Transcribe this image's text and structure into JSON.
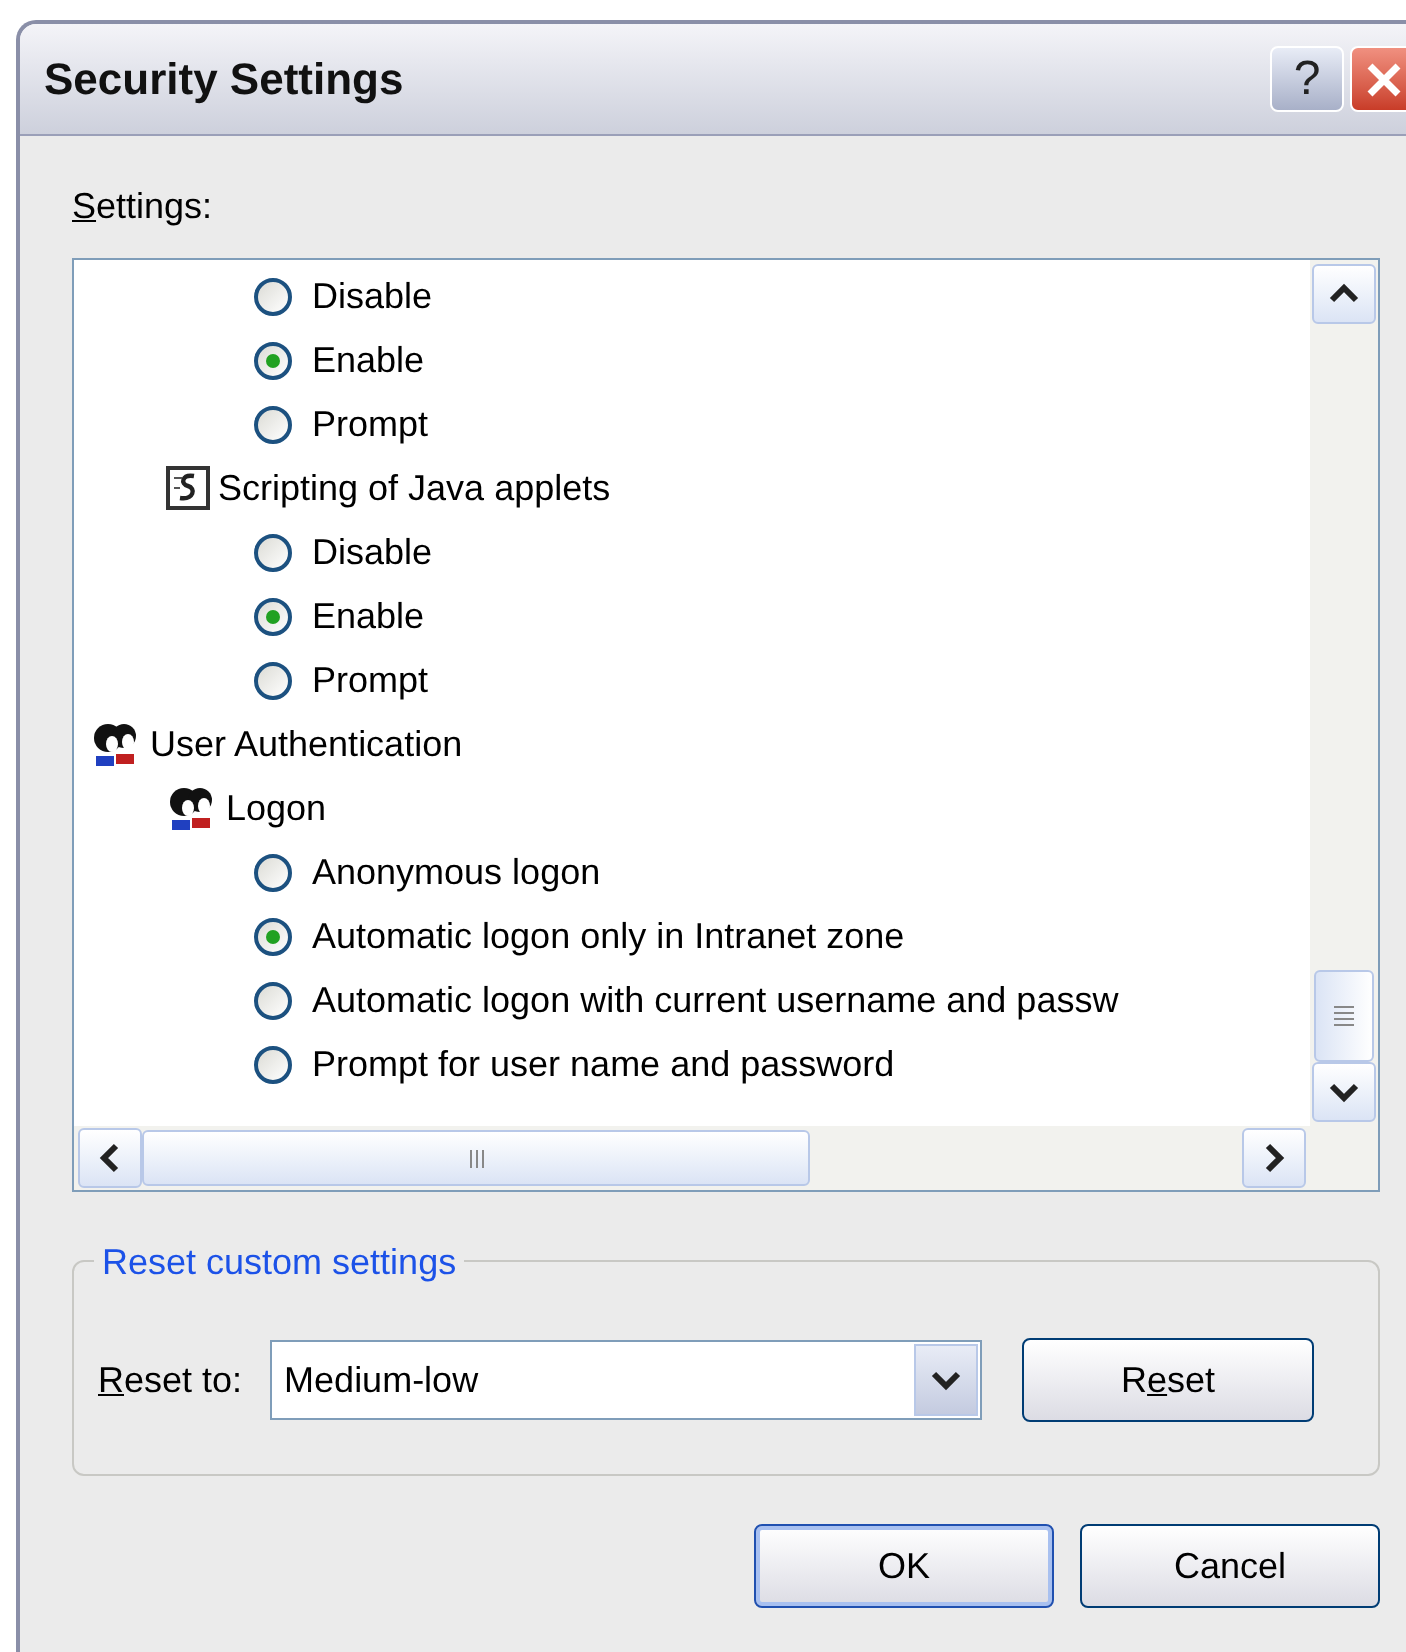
{
  "window": {
    "title": "Security Settings"
  },
  "title_buttons": [
    {
      "kind": "help",
      "label": "?"
    },
    {
      "kind": "close"
    }
  ],
  "settings_label": "Settings:",
  "tree": [
    {
      "children": [
        {
          "children": [
            {
              "label": "Disable",
              "selected": false
            },
            {
              "label": "Enable",
              "selected": true
            },
            {
              "label": "Prompt",
              "selected": false
            }
          ]
        },
        {
          "kind": "script",
          "label": "Scripting of Java applets",
          "children": [
            {
              "label": "Disable",
              "selected": false
            },
            {
              "label": "Enable",
              "selected": true
            },
            {
              "label": "Prompt",
              "selected": false
            }
          ]
        }
      ]
    },
    {
      "kind": "users",
      "label": "User Authentication",
      "children": [
        {
          "kind": "users",
          "label": "Logon",
          "children": [
            {
              "label": "Anonymous logon",
              "selected": false
            },
            {
              "label": "Automatic logon only in Intranet zone",
              "selected": true
            },
            {
              "label": "Automatic logon with current username and passw",
              "selected": false
            },
            {
              "label": "Prompt for user name and password",
              "selected": false
            }
          ]
        }
      ]
    }
  ],
  "reset_group": {
    "title": "Reset custom settings",
    "label": "Reset to:",
    "value": "Medium-low",
    "button": "Reset"
  },
  "buttons": [
    "OK",
    "Cancel"
  ]
}
